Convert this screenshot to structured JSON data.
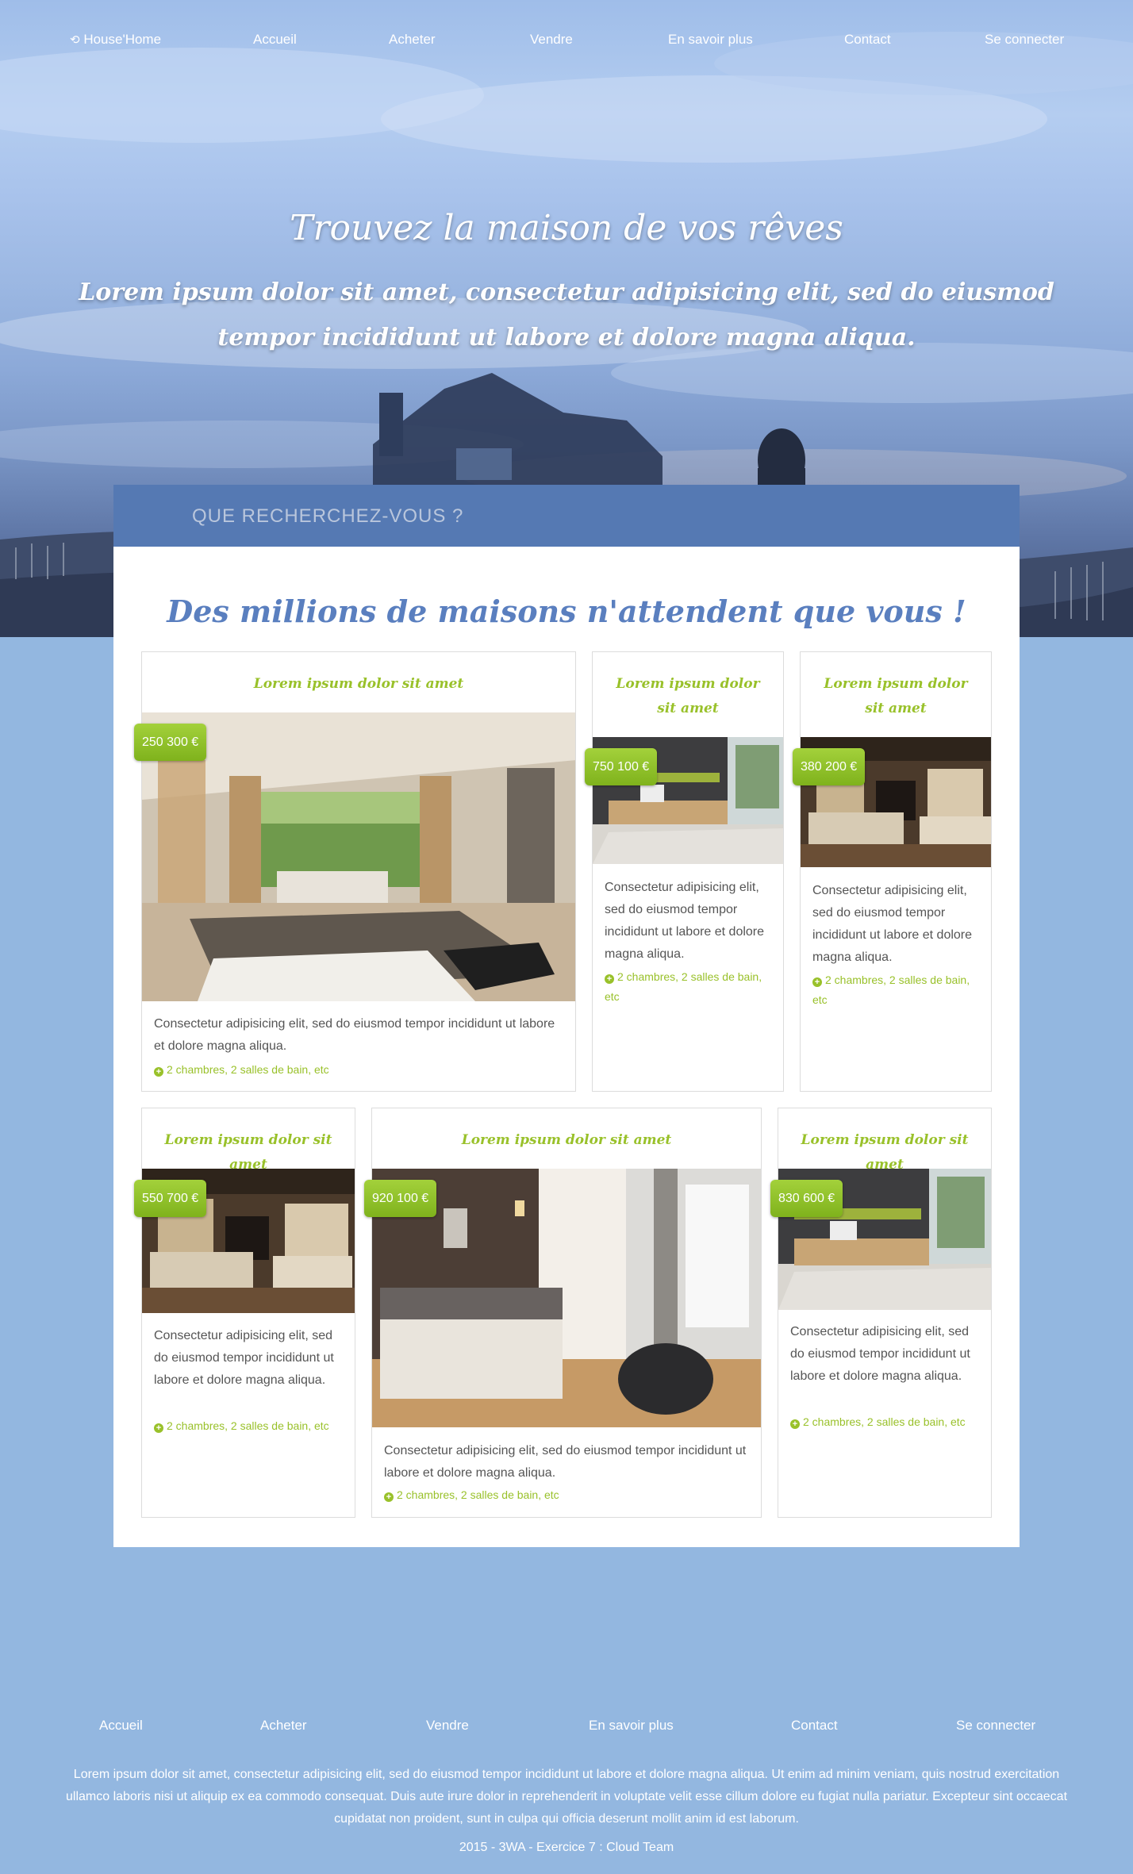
{
  "colors": {
    "accent_green": "#99c12a",
    "accent_blue": "#5a7fbf",
    "search_bar": "#5579b3",
    "page_bg": "#93b7e0"
  },
  "nav": {
    "logo_icon": "refresh-icon",
    "logo": "House'Home",
    "items": [
      "Accueil",
      "Acheter",
      "Vendre",
      "En savoir plus",
      "Contact",
      "Se connecter"
    ]
  },
  "hero": {
    "title": "Trouvez la maison de vos rêves",
    "subtitle": "Lorem ipsum dolor sit amet, consectetur adipisicing elit, sed do eiusmod tempor incididunt ut labore et dolore magna aliqua."
  },
  "search": {
    "label": "QUE RECHERCHEZ-VOUS ?"
  },
  "listings": {
    "heading": "Des millions de maisons n'attendent que vous !",
    "feature_icon": "plus-circle-icon",
    "cards": [
      {
        "title": "Lorem ipsum dolor sit amet",
        "price": "250 300 €",
        "text": "Consectetur adipisicing elit, sed do eiusmod tempor incididunt ut labore et dolore magna aliqua.",
        "features": "2 chambres, 2 salles de bain, etc"
      },
      {
        "title": "Lorem ipsum dolor sit amet",
        "price": "750 100 €",
        "text": "Consectetur adipisicing elit, sed do eiusmod tempor incididunt ut labore et dolore magna aliqua.",
        "features": "2 chambres, 2 salles de bain, etc"
      },
      {
        "title": "Lorem ipsum dolor sit amet",
        "price": "380 200 €",
        "text": "Consectetur adipisicing elit, sed do eiusmod tempor incididunt ut labore et dolore magna aliqua.",
        "features": "2 chambres, 2 salles de bain, etc"
      },
      {
        "title": "Lorem ipsum dolor sit amet",
        "price": "550 700 €",
        "text": "Consectetur adipisicing elit, sed do eiusmod tempor incididunt ut labore et dolore magna aliqua.",
        "features": "2 chambres, 2 salles de bain, etc"
      },
      {
        "title": "Lorem ipsum dolor sit amet",
        "price": "920 100 €",
        "text": "Consectetur adipisicing elit, sed do eiusmod tempor incididunt ut labore et dolore magna aliqua.",
        "features": "2 chambres, 2 salles de bain, etc"
      },
      {
        "title": "Lorem ipsum dolor sit amet",
        "price": "830 600 €",
        "text": "Consectetur adipisicing elit, sed do eiusmod tempor incididunt ut labore et dolore magna aliqua.",
        "features": "2 chambres, 2 salles de bain, etc"
      }
    ]
  },
  "footer": {
    "items": [
      "Accueil",
      "Acheter",
      "Vendre",
      "En savoir plus",
      "Contact",
      "Se connecter"
    ],
    "text": "Lorem ipsum dolor sit amet, consectetur adipisicing elit, sed do eiusmod tempor incididunt ut labore et dolore magna aliqua. Ut enim ad minim veniam, quis nostrud exercitation ullamco laboris nisi ut aliquip ex ea commodo consequat. Duis aute irure dolor in reprehenderit in voluptate velit esse cillum dolore eu fugiat nulla pariatur. Excepteur sint occaecat cupidatat non proident, sunt in culpa qui officia deserunt mollit anim id est laborum.",
    "copyright": "2015 - 3WA - Exercice 7 : Cloud Team"
  }
}
